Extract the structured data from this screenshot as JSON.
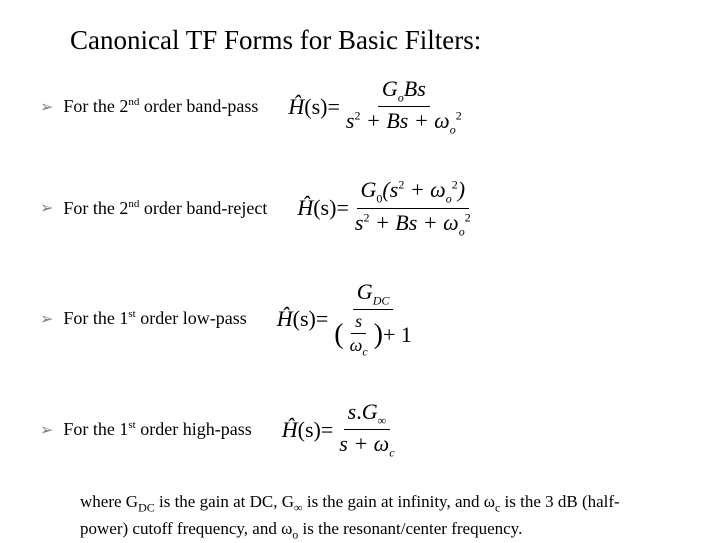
{
  "title": "Canonical TF Forms for Basic Filters:",
  "bullets": {
    "b1": {
      "pre": "For the 2",
      "ord": "nd",
      "post": " order  band-pass"
    },
    "b2": {
      "pre": "For the 2",
      "ord": "nd",
      "post": " order  band-reject"
    },
    "b3": {
      "pre": "For the 1",
      "ord": "st",
      "post": " order  low-pass"
    },
    "b4": {
      "pre": "For the 1",
      "ord": "st",
      "post": " order  high-pass"
    }
  },
  "eq": {
    "hhat": "Ĥ",
    "s_arg": "(s)",
    "eq": " = ",
    "bp_num": "G",
    "bp_num_sub": "o",
    "bp_num_rest": "Bs",
    "denom_s2": "s",
    "denom_sup2": "2",
    "denom_plusBs": " + Bs + ",
    "omega": "ω",
    "denom_wsub": "o",
    "denom_wsup": "2",
    "br_num_pre": "G",
    "br_num_sub": "0",
    "br_num_paren_s2": "(s",
    "br_num_sup": "2",
    "br_num_plus": " + ω",
    "br_num_wsub": "o",
    "br_num_wsup": "2",
    "br_num_close": ")",
    "lp_num": "G",
    "lp_num_sub": "DC",
    "lp_inner_top": "s",
    "lp_inner_bot": "ω",
    "lp_inner_bot_sub": "c",
    "lp_plus1": " + 1",
    "hp_num_pre": "s",
    "hp_num_dot": ".",
    "hp_num_G": "G",
    "hp_num_Gsub": "∞",
    "hp_den": "s + ω",
    "hp_den_sub": "c"
  },
  "foot": {
    "t1": "where G",
    "dc": "DC",
    "t2": " is the gain at DC, G",
    "inf": "∞",
    "t3": " is the gain at infinity, and ω",
    "c1": "c",
    "t4": " is the 3 dB (half-power) cutoff frequency, and ω",
    "o": "o",
    "t5": " is the resonant/center frequency."
  }
}
